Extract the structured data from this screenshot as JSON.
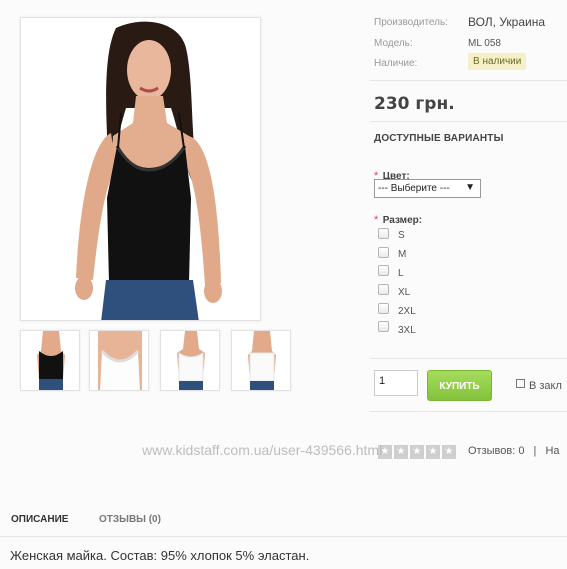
{
  "product": {
    "manufacturer_label": "Производитель:",
    "manufacturer_value": "ВОЛ, Украина",
    "model_label": "Модель:",
    "model_value": "ML 058",
    "availability_label": "Наличие:",
    "availability_value": "В наличии",
    "price": "230 грн."
  },
  "variants": {
    "title": "ДОСТУПНЫЕ ВАРИАНТЫ",
    "color_label": "Цвет:",
    "color_select_value": "--- Выберите ---",
    "size_label": "Размер:",
    "sizes": [
      "S",
      "M",
      "L",
      "XL",
      "2XL",
      "3XL"
    ],
    "required_mark": "*"
  },
  "cart": {
    "quantity": "1",
    "buy_label": "КУПИТЬ",
    "wishlist_label": "В закл"
  },
  "rating": {
    "reviews_text": "Отзывов: 0",
    "separator": "|",
    "write_text": "На"
  },
  "watermark": "www.kidstaff.com.ua/user-439566.html",
  "tabs": {
    "description": "ОПИСАНИЕ",
    "reviews": "ОТЗЫВЫ (0)"
  },
  "description_text": "Женская майка. Состав: 95% хлопок 5% эластан.",
  "colors": {
    "buy_button": "#8cc63f",
    "required": "#e0397a",
    "badge_bg": "#f6f0c6"
  }
}
